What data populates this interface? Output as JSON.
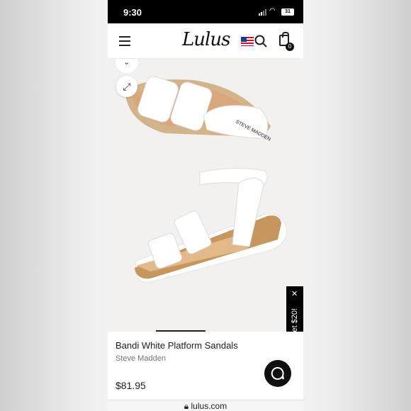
{
  "status_bar": {
    "time": "9:30",
    "battery": "31"
  },
  "nav": {
    "logo": "Lulus",
    "cart_count": "0"
  },
  "hero": {
    "sole_label": "STEVE MADDEN"
  },
  "promo": {
    "label": "Get $20!"
  },
  "product": {
    "title": "Bandi White Platform Sandals",
    "brand": "Steve Madden",
    "price": "$81.95"
  },
  "browser": {
    "url": "lulus.com"
  },
  "colors": {
    "background": "#ffffff",
    "text": "#222222",
    "accent": "#000000"
  }
}
